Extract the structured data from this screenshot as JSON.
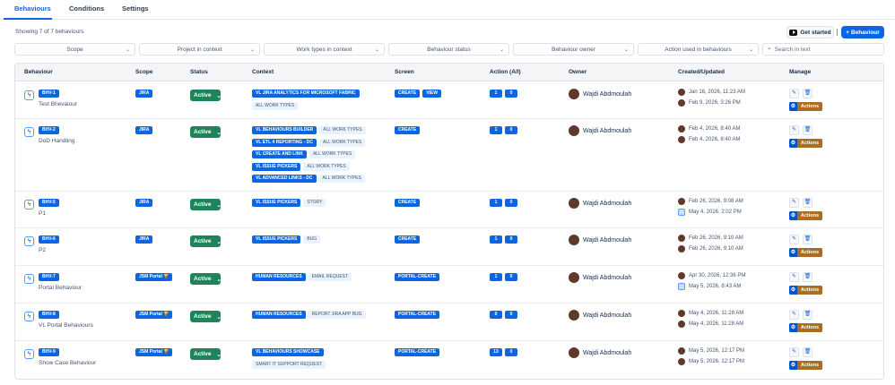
{
  "tabs": [
    {
      "label": "Behaviours"
    },
    {
      "label": "Conditions"
    },
    {
      "label": "Settings"
    }
  ],
  "showing_text": "Showing 7 of 7 behaviours",
  "get_started_label": "Get started",
  "add_behaviour_label": "Behaviour",
  "filters": [
    "Scope",
    "Project in context",
    "Work types in context",
    "Behaviour status",
    "Behaviour owner",
    "Action used in behaviours"
  ],
  "search_placeholder": "Search in text",
  "columns": [
    "Behaviour",
    "Scope",
    "Status",
    "Context",
    "Screen",
    "Action (A/I)",
    "Owner",
    "Created/Updated",
    "Manage"
  ],
  "actions_label": "Actions",
  "rows": [
    {
      "id": "BHV-1",
      "name": "Test Bhevaiour",
      "scope": "JIRA",
      "status": "Active",
      "context": [
        [
          "VL JIRA ANALYTICS FOR MICROSOFT FABRIC"
        ],
        [
          "ALL WORK TYPES"
        ]
      ],
      "screens": [
        "CREATE",
        "VIEW"
      ],
      "a": "1",
      "i": "0",
      "owner": "Wajdi Abdmoulah",
      "created": "Jan 16, 2026, 11:23 AM",
      "updated": "Feb 9, 2026, 3:26 PM",
      "updated_icon": "avatar"
    },
    {
      "id": "BHV-2",
      "name": "DoD Handling",
      "scope": "JIRA",
      "status": "Active",
      "context": [
        [
          "VL BEHAVIOURS BUILDER",
          "ALL WORK TYPES"
        ],
        [
          "VL ETL 4 REPORTING - DC",
          "ALL WORK TYPES"
        ],
        [
          "VL CREATE AND LINK",
          "ALL WORK TYPES"
        ],
        [
          "VL ISSUE PICKERS",
          "ALL WORK TYPES"
        ],
        [
          "VL ADVANCED LINKS - DC",
          "ALL WORK TYPES"
        ]
      ],
      "screens": [
        "CREATE"
      ],
      "a": "1",
      "i": "0",
      "owner": "Wajdi Abdmoulah",
      "created": "Feb 4, 2026, 8:40 AM",
      "updated": "Feb 4, 2026, 8:40 AM",
      "updated_icon": "avatar"
    },
    {
      "id": "BHV-5",
      "name": "P1",
      "scope": "JIRA",
      "status": "Active",
      "context": [
        [
          "VL ISSUE PICKERS",
          "STORY"
        ]
      ],
      "screens": [
        "CREATE"
      ],
      "a": "1",
      "i": "0",
      "owner": "Wajdi Abdmoulah",
      "created": "Feb 26, 2026, 9:08 AM",
      "updated": "May 4, 2026, 2:02 PM",
      "updated_icon": "app"
    },
    {
      "id": "BHV-6",
      "name": "P2",
      "scope": "JIRA",
      "status": "Active",
      "context": [
        [
          "VL ISSUE PICKERS",
          "BUG"
        ]
      ],
      "screens": [
        "CREATE"
      ],
      "a": "1",
      "i": "0",
      "owner": "Wajdi Abdmoulah",
      "created": "Feb 26, 2026, 9:10 AM",
      "updated": "Feb 26, 2026, 9:10 AM",
      "updated_icon": "avatar"
    },
    {
      "id": "BHV-7",
      "name": "Portal Behaviour",
      "scope": "JSM Portal 🏆",
      "status": "Active",
      "context": [
        [
          "HUMAN RESOURCES",
          "EMAIL REQUEST"
        ]
      ],
      "screens": [
        "PORTAL-CREATE"
      ],
      "a": "1",
      "i": "0",
      "owner": "Wajdi Abdmoulah",
      "created": "Apr 30, 2026, 12:36 PM",
      "updated": "May 5, 2026, 8:43 AM",
      "updated_icon": "app"
    },
    {
      "id": "BHV-8",
      "name": "VL Portal Behaviours",
      "scope": "JSM Portal 🏆",
      "status": "Active",
      "context": [
        [
          "HUMAN RESOURCES",
          "REPORT JIRA APP BUG"
        ]
      ],
      "screens": [
        "PORTAL-CREATE"
      ],
      "a": "0",
      "i": "0",
      "owner": "Wajdi Abdmoulah",
      "created": "May 4, 2026, 11:28 AM",
      "updated": "May 4, 2026, 11:28 AM",
      "updated_icon": "avatar"
    },
    {
      "id": "BHV-9",
      "name": "Show Case Behaviour",
      "scope": "JSM Portal 🏆",
      "status": "Active",
      "context": [
        [
          "VL BEHAVIOURS SHOWCASE"
        ],
        [
          "SMART IT SUPPORT REQUEST"
        ]
      ],
      "screens": [
        "PORTAL-CREATE"
      ],
      "a": "13",
      "i": "0",
      "owner": "Wajdi Abdmoulah",
      "created": "May 5, 2026, 12:17 PM",
      "updated": "May 5, 2026, 12:17 PM",
      "updated_icon": "avatar"
    }
  ]
}
